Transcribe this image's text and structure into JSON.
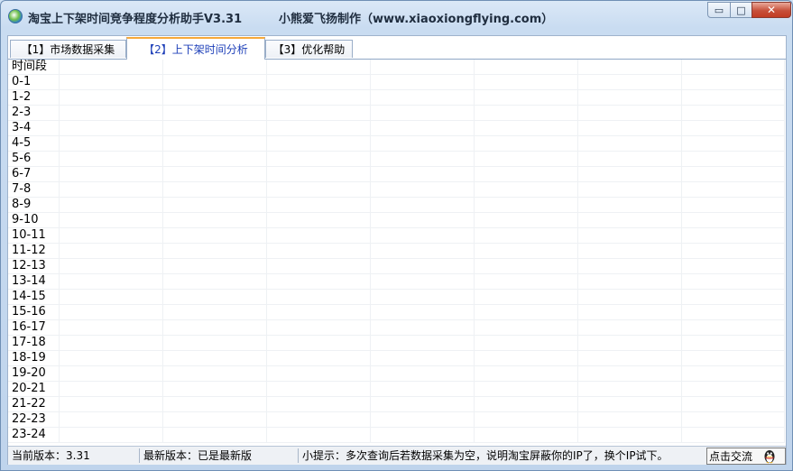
{
  "window": {
    "title": "淘宝上下架时间竞争程度分析助手V3.31",
    "author": "小熊爱飞扬制作（www.xiaoxiongflying.com）",
    "min_glyph": "▭",
    "max_glyph": "□",
    "close_glyph": "✕"
  },
  "tabs": [
    {
      "label": "【1】市场数据采集"
    },
    {
      "label": "【2】上下架时间分析"
    },
    {
      "label": "【3】优化帮助"
    }
  ],
  "grid": {
    "header": "时间段",
    "rows": [
      "0-1",
      "1-2",
      "2-3",
      "3-4",
      "4-5",
      "5-6",
      "6-7",
      "7-8",
      "8-9",
      "9-10",
      "10-11",
      "11-12",
      "12-13",
      "13-14",
      "14-15",
      "15-16",
      "16-17",
      "17-18",
      "18-19",
      "19-20",
      "20-21",
      "21-22",
      "22-23",
      "23-24"
    ]
  },
  "status": {
    "current_version": "当前版本：3.31",
    "latest_version": "最新版本：已是最新版",
    "tip": "小提示：多次查询后若数据采集为空，说明淘宝屏蔽你的IP了，换个IP试下。",
    "chat_label": "点击交流"
  },
  "icons": {
    "app": "app-globe-icon",
    "chat": "qq-penguin-icon"
  },
  "colors": {
    "active_tab_text": "#1d3fb8",
    "active_tab_accent": "#f6a93b"
  }
}
